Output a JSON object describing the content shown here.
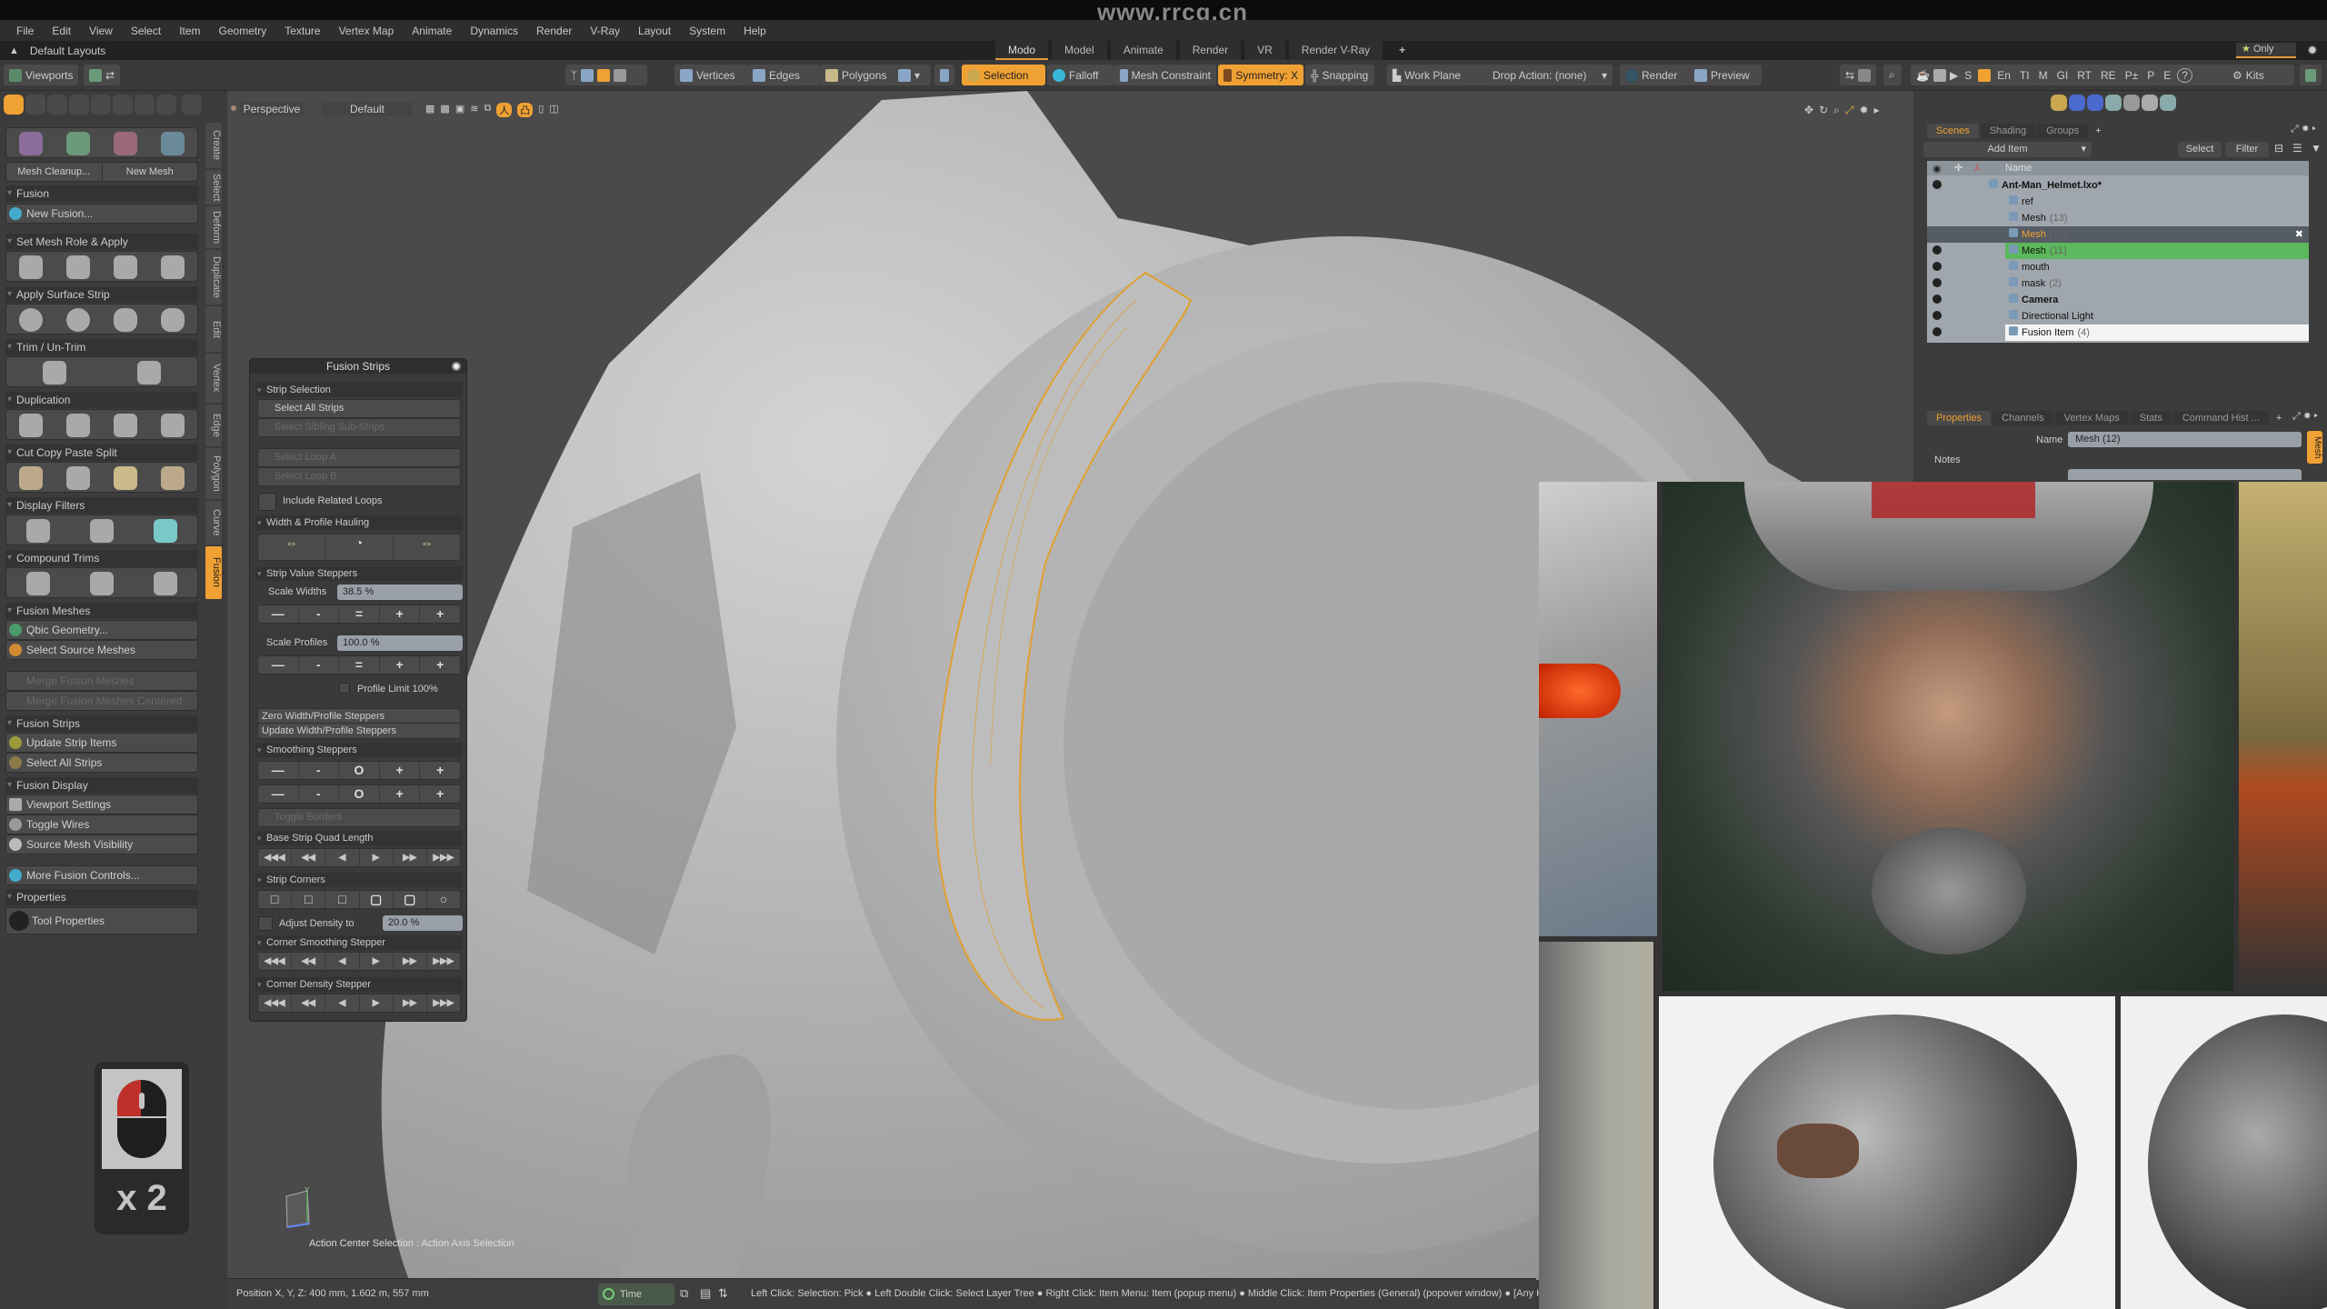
{
  "title_watermark": "www.rrcg.cn",
  "menu": [
    "File",
    "Edit",
    "View",
    "Select",
    "Item",
    "Geometry",
    "Texture",
    "Vertex Map",
    "Animate",
    "Dynamics",
    "Render",
    "V-Ray",
    "Layout",
    "System",
    "Help"
  ],
  "layout": {
    "label": "Default Layouts",
    "tabs": [
      "Modo",
      "Model",
      "Animate",
      "Render",
      "VR",
      "Render V-Ray"
    ],
    "active_tab": "Modo",
    "add_tab": "+",
    "only_label": "Only"
  },
  "toolbar": {
    "viewports": "Viewports",
    "vertices": "Vertices",
    "edges": "Edges",
    "polygons": "Polygons",
    "selection": "Selection",
    "falloff": "Falloff",
    "mesh_constraint": "Mesh Constraint",
    "symmetry": "Symmetry: X",
    "snapping": "Snapping",
    "work_plane": "Work Plane",
    "drop_action": "Drop Action: (none)",
    "render": "Render",
    "preview": "Preview",
    "kits": "Kits",
    "quick_letters": [
      "S",
      "En",
      "TI",
      "M",
      "GI",
      "RT",
      "RE",
      "P±",
      "P",
      "E"
    ]
  },
  "left_panel": {
    "mesh_cleanup": "Mesh Cleanup...",
    "new_mesh": "New Mesh",
    "sections": {
      "fusion": "Fusion",
      "set_mesh_role": "Set Mesh Role & Apply",
      "apply_surface_strip": "Apply Surface Strip",
      "trim": "Trim / Un-Trim",
      "duplication": "Duplication",
      "cut_copy": "Cut Copy Paste Split",
      "display_filters": "Display Filters",
      "compound_trims": "Compound Trims",
      "fusion_meshes": "Fusion Meshes",
      "fusion_strips": "Fusion Strips",
      "fusion_display": "Fusion Display",
      "properties": "Properties"
    },
    "new_fusion": "New Fusion...",
    "qbic_geometry": "Qbic Geometry...",
    "select_source_meshes": "Select Source Meshes",
    "merge_fusion_meshes": "Merge Fusion Meshes",
    "merge_fusion_meshes_centered": "Merge Fusion Meshes Centered",
    "update_strip_items": "Update Strip Items",
    "select_all_strips": "Select All Strips",
    "viewport_settings": "Viewport Settings",
    "toggle_wires": "Toggle Wires",
    "source_mesh_visibility": "Source Mesh Visibility",
    "more_fusion_controls": "More Fusion Controls...",
    "tool_properties": "Tool Properties"
  },
  "vertical_tabs": [
    "Create",
    "Select",
    "Deform",
    "Duplicate",
    "Edit",
    "Vertex",
    "Edge",
    "Polygon",
    "Curve",
    "Fusion"
  ],
  "active_vertical_tab": "Fusion",
  "viewport": {
    "view": "Perspective",
    "shading": "Default",
    "action_center": "Action Center Selection : Action Axis Selection"
  },
  "fusion_strips_panel": {
    "title": "Fusion Strips",
    "strip_selection": "Strip Selection",
    "select_all_strips": "Select All Strips",
    "select_sibling": "Select Sibling Sub-Strips",
    "select_loop_a": "Select Loop A",
    "select_loop_b": "Select Loop B",
    "include_related_loops": "Include Related Loops",
    "width_profile_hauling": "Width & Profile Hauling",
    "strip_value_steppers": "Strip Value Steppers",
    "scale_widths_label": "Scale Widths",
    "scale_widths_value": "38.5 %",
    "scale_profiles_label": "Scale Profiles",
    "scale_profiles_value": "100.0 %",
    "stepper_symbols": [
      "—",
      "-",
      "=",
      "+",
      "+"
    ],
    "profile_limit": "Profile Limit 100%",
    "zero_steppers": "Zero Width/Profile Steppers",
    "update_steppers": "Update Width/Profile Steppers",
    "smoothing_steppers": "Smoothing Steppers",
    "smoothing_symbols": [
      "—",
      "-",
      "O",
      "+",
      "+"
    ],
    "toggle_borders": "Toggle Borders",
    "base_strip_quad_length": "Base Strip Quad Length",
    "arrow_symbols": [
      "◀◀◀",
      "◀◀",
      "◀",
      "▶",
      "▶▶",
      "▶▶▶"
    ],
    "strip_corners": "Strip Corners",
    "adjust_density_label": "Adjust Density to",
    "adjust_density_value": "20.0 %",
    "corner_smoothing_stepper": "Corner Smoothing Stepper",
    "corner_density_stepper": "Corner Density Stepper"
  },
  "mouse_hint": {
    "count": "x 2"
  },
  "scene_panel": {
    "tabs": [
      "Scenes",
      "Shading",
      "Groups"
    ],
    "active_tab": "Scenes",
    "add_item": "Add Item",
    "select": "Select",
    "filter": "Filter",
    "name_header": "Name",
    "items": [
      {
        "name": "Ant-Man_Helmet.lxo*",
        "count": "",
        "state": "root"
      },
      {
        "name": "ref",
        "count": "",
        "state": "normal"
      },
      {
        "name": "Mesh",
        "count": "(13)",
        "state": "normal"
      },
      {
        "name": "Mesh",
        "count": "(12)",
        "state": "hover"
      },
      {
        "name": "Mesh",
        "count": "(11)",
        "state": "selected"
      },
      {
        "name": "mouth",
        "count": "",
        "state": "normal"
      },
      {
        "name": "mask",
        "count": "(2)",
        "state": "normal"
      },
      {
        "name": "Camera",
        "count": "",
        "state": "bold"
      },
      {
        "name": "Directional Light",
        "count": "",
        "state": "normal"
      },
      {
        "name": "Fusion Item",
        "count": "(4)",
        "state": "white"
      }
    ]
  },
  "properties_panel": {
    "tabs": [
      "Properties",
      "Channels",
      "Vertex Maps",
      "Stats",
      "Command Hist ..."
    ],
    "active_tab": "Properties",
    "name_label": "Name",
    "name_value": "Mesh (12)",
    "notes_label": "Notes",
    "side_tab": "Mesh"
  },
  "status": {
    "position": "Position X, Y, Z:   400 mm, 1.602 m, 557 mm",
    "time": "Time",
    "hints": "Left Click: Selection: Pick ● Left Double Click: Select Layer Tree ● Right Click: Item Menu: Item (popup menu) ● Middle Click: Item Properties (General) (popover window) ● [Any K"
  },
  "colors": {
    "accent": "#f0a133",
    "selected_row": "#5cb85c",
    "panel_bg": "#3c3c3c"
  }
}
